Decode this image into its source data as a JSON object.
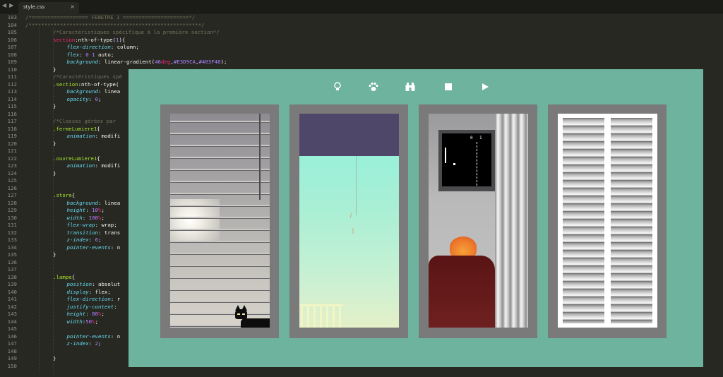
{
  "editor": {
    "tab": {
      "filename": "style.css",
      "close": "×"
    },
    "nav": {
      "back": "◀",
      "forward": "▶"
    },
    "lines": [
      {
        "n": "103",
        "indent": 0,
        "parts": [
          [
            "com",
            "/*================== FENETRE 1 =====================*/"
          ]
        ]
      },
      {
        "n": "104",
        "indent": 0,
        "parts": [
          [
            "com",
            "/*******************************************************/"
          ]
        ]
      },
      {
        "n": "105",
        "indent": 2,
        "parts": [
          [
            "com",
            "/*Caractéristiques spécifique à la première section*/"
          ]
        ]
      },
      {
        "n": "106",
        "indent": 2,
        "parts": [
          [
            "sel",
            "section"
          ],
          [
            "pct",
            ":nth-of-type("
          ],
          [
            "num",
            "1"
          ],
          [
            "pct",
            "){"
          ]
        ]
      },
      {
        "n": "107",
        "indent": 3,
        "parts": [
          [
            "prop",
            "flex-direction"
          ],
          [
            "pct",
            ": "
          ],
          [
            "val",
            "column"
          ],
          [
            "pct",
            ";"
          ]
        ]
      },
      {
        "n": "108",
        "indent": 3,
        "parts": [
          [
            "prop",
            "flex"
          ],
          [
            "pct",
            ": "
          ],
          [
            "num",
            "0 1"
          ],
          [
            "val",
            " auto"
          ],
          [
            "pct",
            ";"
          ]
        ]
      },
      {
        "n": "109",
        "indent": 3,
        "parts": [
          [
            "prop",
            "background"
          ],
          [
            "pct",
            ": "
          ],
          [
            "val",
            "linear-gradient("
          ],
          [
            "num",
            "46"
          ],
          [
            "unit",
            "deg"
          ],
          [
            "pct",
            ","
          ],
          [
            "num",
            "#E3D9CA"
          ],
          [
            "pct",
            ","
          ],
          [
            "num",
            "#403F48"
          ],
          [
            "pct",
            ");"
          ]
        ]
      },
      {
        "n": "110",
        "indent": 2,
        "parts": [
          [
            "pct",
            "}"
          ]
        ]
      },
      {
        "n": "111",
        "indent": 2,
        "parts": [
          [
            "com",
            "/*Caractéristiques spé"
          ]
        ]
      },
      {
        "n": "112",
        "indent": 2,
        "parts": [
          [
            "cls",
            ".section"
          ],
          [
            "pct",
            ":nth-of-type("
          ]
        ]
      },
      {
        "n": "113",
        "indent": 3,
        "parts": [
          [
            "prop",
            "background"
          ],
          [
            "pct",
            ": "
          ],
          [
            "val",
            "linea"
          ]
        ]
      },
      {
        "n": "114",
        "indent": 3,
        "parts": [
          [
            "prop",
            "opacity"
          ],
          [
            "pct",
            ": "
          ],
          [
            "num",
            "0"
          ],
          [
            "pct",
            ";"
          ]
        ]
      },
      {
        "n": "115",
        "indent": 2,
        "parts": [
          [
            "pct",
            "}"
          ]
        ]
      },
      {
        "n": "116",
        "indent": 0,
        "parts": []
      },
      {
        "n": "117",
        "indent": 2,
        "parts": [
          [
            "com",
            "/*Classes gérées par "
          ]
        ]
      },
      {
        "n": "118",
        "indent": 2,
        "parts": [
          [
            "cls",
            ".fermeLumiere1"
          ],
          [
            "pct",
            "{"
          ]
        ]
      },
      {
        "n": "119",
        "indent": 3,
        "parts": [
          [
            "prop",
            "animation"
          ],
          [
            "pct",
            ": "
          ],
          [
            "val",
            "modifi"
          ]
        ]
      },
      {
        "n": "120",
        "indent": 2,
        "parts": [
          [
            "pct",
            "}"
          ]
        ]
      },
      {
        "n": "121",
        "indent": 0,
        "parts": []
      },
      {
        "n": "122",
        "indent": 2,
        "parts": [
          [
            "cls",
            ".ouvreLumiere1"
          ],
          [
            "pct",
            "{"
          ]
        ]
      },
      {
        "n": "123",
        "indent": 3,
        "parts": [
          [
            "prop",
            "animation"
          ],
          [
            "pct",
            ": "
          ],
          [
            "val",
            "modifi"
          ]
        ]
      },
      {
        "n": "124",
        "indent": 2,
        "parts": [
          [
            "pct",
            "}"
          ]
        ]
      },
      {
        "n": "125",
        "indent": 0,
        "parts": []
      },
      {
        "n": "126",
        "indent": 0,
        "parts": []
      },
      {
        "n": "127",
        "indent": 2,
        "parts": [
          [
            "cls",
            ".store"
          ],
          [
            "pct",
            "{"
          ]
        ]
      },
      {
        "n": "128",
        "indent": 3,
        "parts": [
          [
            "prop",
            "background"
          ],
          [
            "pct",
            ": "
          ],
          [
            "val",
            "linea"
          ]
        ]
      },
      {
        "n": "129",
        "indent": 3,
        "parts": [
          [
            "prop",
            "height"
          ],
          [
            "pct",
            ": "
          ],
          [
            "num",
            "10"
          ],
          [
            "unit",
            "%"
          ],
          [
            "pct",
            ";"
          ]
        ]
      },
      {
        "n": "130",
        "indent": 3,
        "parts": [
          [
            "prop",
            "width"
          ],
          [
            "pct",
            ": "
          ],
          [
            "num",
            "100"
          ],
          [
            "unit",
            "%"
          ],
          [
            "pct",
            ";"
          ]
        ]
      },
      {
        "n": "131",
        "indent": 3,
        "parts": [
          [
            "prop",
            "flex-wrap"
          ],
          [
            "pct",
            ": "
          ],
          [
            "val",
            "wrap"
          ],
          [
            "pct",
            ";"
          ]
        ]
      },
      {
        "n": "132",
        "indent": 3,
        "parts": [
          [
            "prop",
            "transition"
          ],
          [
            "pct",
            ": "
          ],
          [
            "val",
            "trans"
          ]
        ]
      },
      {
        "n": "133",
        "indent": 3,
        "parts": [
          [
            "prop",
            "z-index"
          ],
          [
            "pct",
            ": "
          ],
          [
            "num",
            "6"
          ],
          [
            "pct",
            ";"
          ]
        ]
      },
      {
        "n": "134",
        "indent": 3,
        "parts": [
          [
            "prop",
            "pointer-events"
          ],
          [
            "pct",
            ": "
          ],
          [
            "val",
            "n"
          ]
        ]
      },
      {
        "n": "135",
        "indent": 2,
        "parts": [
          [
            "pct",
            "}"
          ]
        ]
      },
      {
        "n": "136",
        "indent": 0,
        "parts": []
      },
      {
        "n": "137",
        "indent": 0,
        "parts": []
      },
      {
        "n": "138",
        "indent": 2,
        "parts": [
          [
            "cls",
            ".lampe"
          ],
          [
            "pct",
            "{"
          ]
        ]
      },
      {
        "n": "139",
        "indent": 3,
        "parts": [
          [
            "prop",
            "position"
          ],
          [
            "pct",
            ": "
          ],
          [
            "val",
            "absolut"
          ]
        ]
      },
      {
        "n": "140",
        "indent": 3,
        "parts": [
          [
            "prop",
            "display"
          ],
          [
            "pct",
            ": "
          ],
          [
            "val",
            "flex"
          ],
          [
            "pct",
            ";"
          ]
        ]
      },
      {
        "n": "141",
        "indent": 3,
        "parts": [
          [
            "prop",
            "flex-direction"
          ],
          [
            "pct",
            ": "
          ],
          [
            "val",
            "r"
          ]
        ]
      },
      {
        "n": "142",
        "indent": 3,
        "parts": [
          [
            "prop",
            "justify-content"
          ],
          [
            "pct",
            ": "
          ]
        ]
      },
      {
        "n": "143",
        "indent": 3,
        "parts": [
          [
            "prop",
            "height"
          ],
          [
            "pct",
            ": "
          ],
          [
            "num",
            "80"
          ],
          [
            "unit",
            "%"
          ],
          [
            "pct",
            ";"
          ]
        ]
      },
      {
        "n": "144",
        "indent": 3,
        "parts": [
          [
            "prop",
            "width"
          ],
          [
            "pct",
            ":"
          ],
          [
            "num",
            "50"
          ],
          [
            "unit",
            "%"
          ],
          [
            "pct",
            ";"
          ]
        ]
      },
      {
        "n": "145",
        "indent": 0,
        "parts": []
      },
      {
        "n": "146",
        "indent": 3,
        "parts": [
          [
            "prop",
            "pointer-events"
          ],
          [
            "pct",
            ": "
          ],
          [
            "val",
            "n"
          ]
        ]
      },
      {
        "n": "147",
        "indent": 3,
        "parts": [
          [
            "prop",
            "z-index"
          ],
          [
            "pct",
            ": "
          ],
          [
            "num",
            "2"
          ],
          [
            "pct",
            ";"
          ]
        ]
      },
      {
        "n": "148",
        "indent": 0,
        "parts": []
      },
      {
        "n": "149",
        "indent": 2,
        "parts": [
          [
            "pct",
            "}"
          ]
        ]
      },
      {
        "n": "150",
        "indent": 0,
        "parts": []
      }
    ]
  },
  "app": {
    "background": "#6db39d",
    "toolbar": [
      {
        "name": "lightbulb-icon"
      },
      {
        "name": "paw-icon"
      },
      {
        "name": "binoculars-icon"
      },
      {
        "name": "stop-icon"
      },
      {
        "name": "play-icon"
      }
    ],
    "windows": [
      {
        "name": "window-blinds-cat"
      },
      {
        "name": "window-dawn-crib"
      },
      {
        "name": "window-tv-armchair"
      },
      {
        "name": "window-shutters"
      }
    ],
    "tv": {
      "score_left": "0",
      "score_right": "1"
    }
  }
}
